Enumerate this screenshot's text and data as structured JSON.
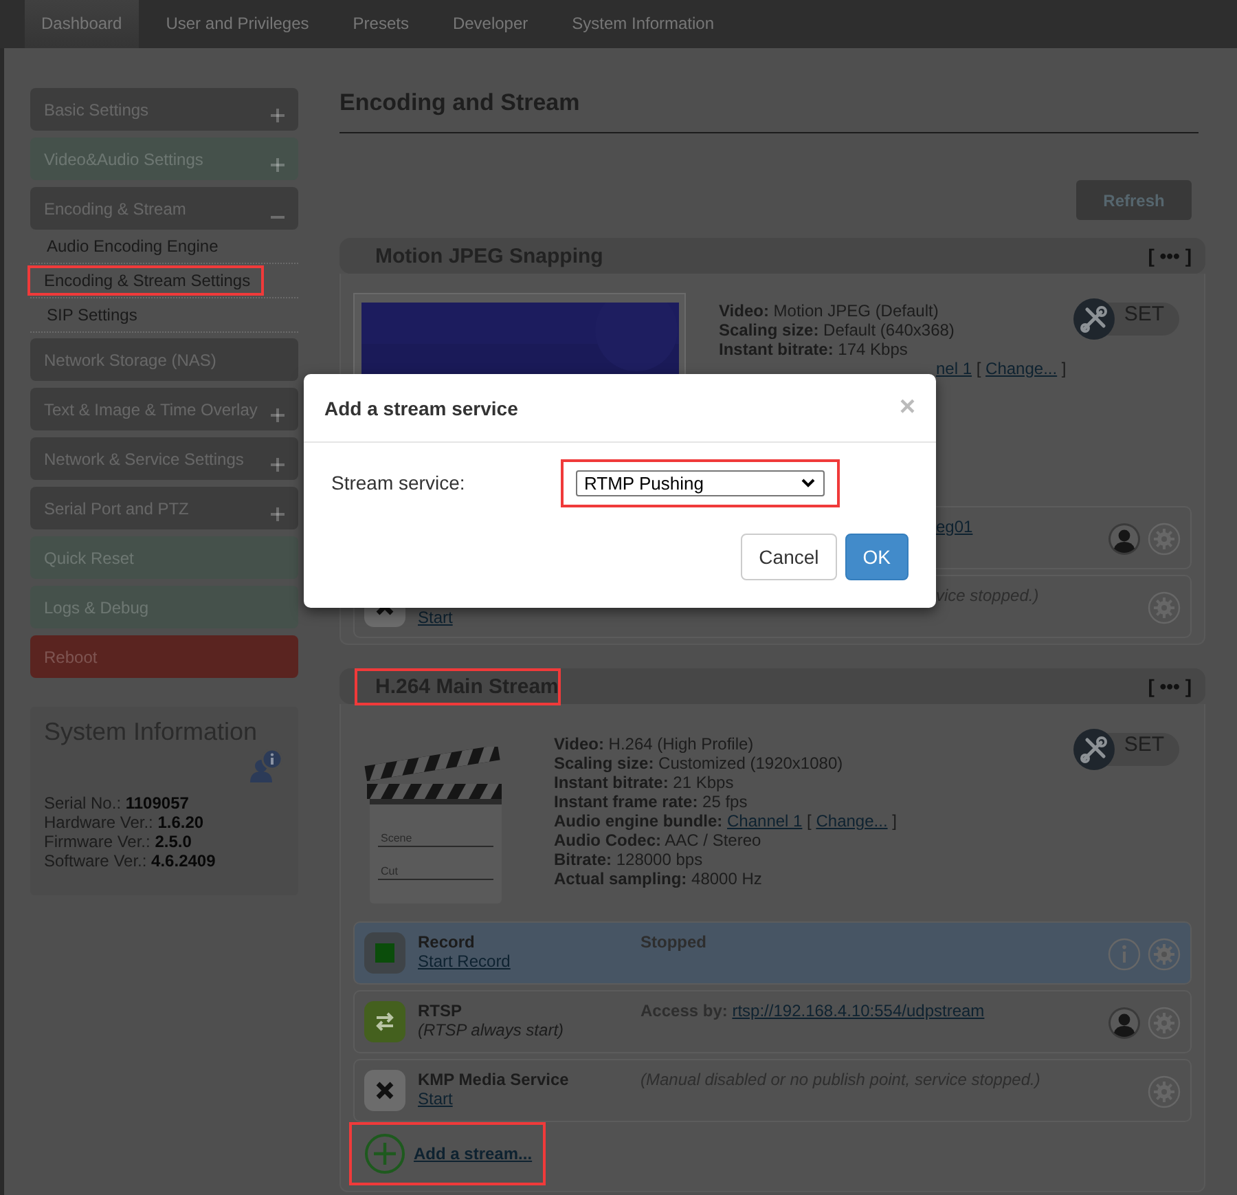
{
  "nav": {
    "tabs": [
      {
        "label": "Dashboard",
        "selected": true
      },
      {
        "label": "User and Privileges",
        "selected": false
      },
      {
        "label": "Presets",
        "selected": false
      },
      {
        "label": "Developer",
        "selected": false
      },
      {
        "label": "System Information",
        "selected": false
      }
    ]
  },
  "sidebar": {
    "items": [
      {
        "label": "Basic Settings",
        "color": "#3d3d3d",
        "expanded": false
      },
      {
        "label": "Video&Audio Settings",
        "color": "#45514b",
        "expanded": false
      },
      {
        "label": "Encoding & Stream",
        "color": "#3d3d3d",
        "expanded": true,
        "children": [
          {
            "label": "Audio Encoding Engine",
            "highlighted": false
          },
          {
            "label": "Encoding & Stream Settings",
            "highlighted": true
          },
          {
            "label": "SIP Settings",
            "highlighted": false
          }
        ]
      },
      {
        "label": "Network Storage (NAS)",
        "color": "#3d3d3d"
      },
      {
        "label": "Text & Image & Time Overlay",
        "color": "#3d3d3d",
        "expanded": false
      },
      {
        "label": "Network & Service Settings",
        "color": "#3d3d3d",
        "expanded": false
      },
      {
        "label": "Serial Port and PTZ",
        "color": "#3d3d3d",
        "expanded": false
      },
      {
        "label": "Quick Reset",
        "color": "#45514b"
      },
      {
        "label": "Logs & Debug",
        "color": "#45514b"
      },
      {
        "label": "Reboot",
        "color": "#5a2420"
      }
    ]
  },
  "system_info": {
    "title": "System Information",
    "fields": [
      {
        "label": "Serial No.:",
        "value": "1109057"
      },
      {
        "label": "Hardware Ver.:",
        "value": "1.6.20"
      },
      {
        "label": "Firmware Ver.:",
        "value": "2.5.0"
      },
      {
        "label": "Software Ver.:",
        "value": "4.6.2409"
      }
    ]
  },
  "main": {
    "title": "Encoding and Stream",
    "refresh_button": "Refresh"
  },
  "sections": [
    {
      "title": "Motion JPEG Snapping",
      "highlighted": false,
      "more": "[ ••• ]",
      "covered": true,
      "preview": {
        "kind": "picture"
      },
      "set_button": "SET",
      "info": [
        {
          "label": "Video:",
          "value": "Motion JPEG (Default)"
        },
        {
          "label": "Scaling size:",
          "value": "Default (640x368)"
        },
        {
          "label": "Instant bitrate:",
          "value": "174 Kbps"
        },
        {
          "link": "nel 1",
          "open": "[",
          "link2": "Change...",
          "close": "]"
        }
      ],
      "services": [
        {
          "kind": "rtsp",
          "access_link": "eg01"
        },
        {
          "kind": "kmp",
          "action": "Start",
          "note": "vice stopped.)"
        }
      ]
    },
    {
      "title": "H.264 Main Stream",
      "highlighted": true,
      "more": "[ ••• ]",
      "covered": false,
      "preview": {
        "kind": "clapperboard",
        "labels": [
          "Scene",
          "Cut"
        ]
      },
      "set_button": "SET",
      "info": [
        {
          "label": "Video:",
          "value": "H.264 (High Profile)"
        },
        {
          "label": "Scaling size:",
          "value": "Customized (1920x1080)"
        },
        {
          "label": "Instant bitrate:",
          "value": "21 Kbps"
        },
        {
          "label": "Instant frame rate:",
          "value": "25 fps"
        },
        {
          "label": "Audio engine bundle:",
          "link": "Channel 1",
          "open": "[",
          "link2": "Change...",
          "close": "]"
        },
        {
          "label": "Audio Codec:",
          "value": "AAC / Stereo"
        },
        {
          "label": "Bitrate:",
          "value": "128000 bps"
        },
        {
          "label": "Actual sampling:",
          "value": "48000 Hz"
        }
      ],
      "services": [
        {
          "kind": "record",
          "name": "Record",
          "action": "Start Record",
          "status": "Stopped",
          "active": true
        },
        {
          "kind": "rtsp",
          "name": "RTSP",
          "subtitle": "(RTSP always start)",
          "access_label": "Access by:",
          "access_link": "rtsp://192.168.4.10:554/udpstream",
          "active": false
        },
        {
          "kind": "kmp",
          "name": "KMP Media Service",
          "action": "Start",
          "note": "(Manual disabled or no publish point, service stopped.)",
          "active": false
        }
      ],
      "add_link": {
        "label": "Add a stream...",
        "highlighted": true
      }
    }
  ],
  "dialog": {
    "title": "Add a stream service",
    "close": "×",
    "fields": [
      {
        "label": "Stream service:",
        "value": "RTMP Pushing",
        "highlighted": true
      }
    ],
    "buttons": [
      {
        "label": "Cancel",
        "kind": "default"
      },
      {
        "label": "OK",
        "kind": "primary"
      }
    ]
  }
}
